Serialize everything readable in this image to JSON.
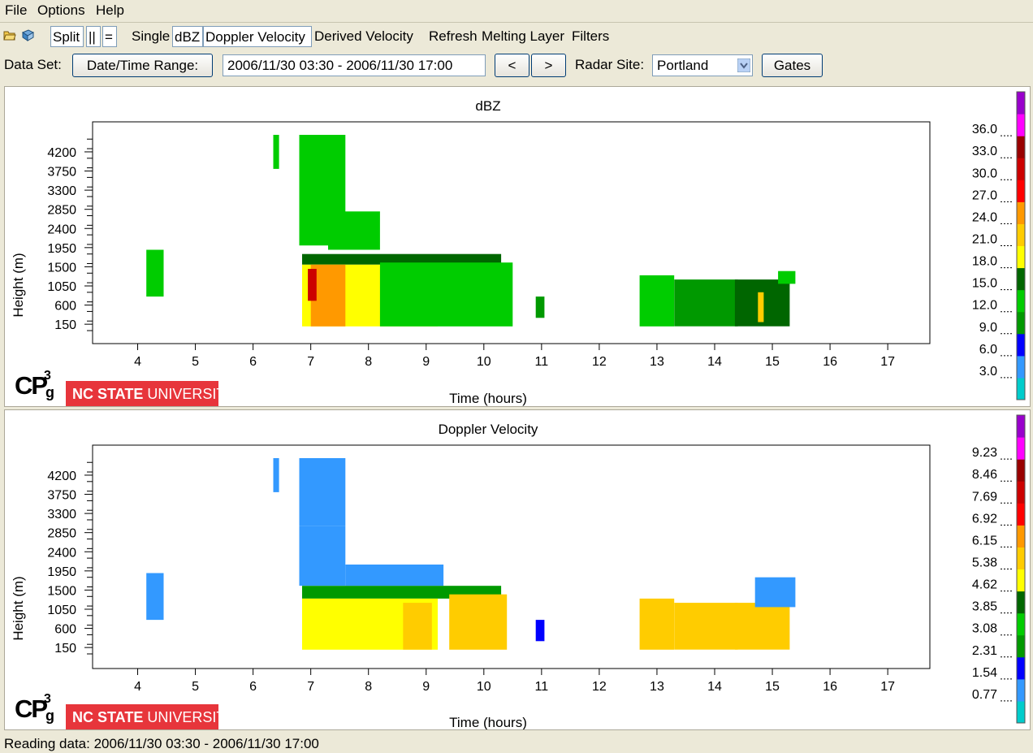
{
  "menu": {
    "items": [
      "File",
      "Options",
      "Help"
    ]
  },
  "toolbar": {
    "open_icon": "open-file-icon",
    "save_icon": "save-icon",
    "split_label": "Split",
    "side_label": "||",
    "stack_label": "=",
    "single_label": "Single",
    "dbz_label": "dBZ",
    "doppler_label": "Doppler Velocity",
    "derived_label": "Derived Velocity",
    "refresh_label": "Refresh",
    "melting_label": "Melting Layer",
    "filters_label": "Filters"
  },
  "dataset": {
    "label": "Data Set:",
    "range_button": "Date/Time Range:",
    "range_value": "2006/11/30 03:30 - 2006/11/30 17:00",
    "prev_label": "<",
    "next_label": ">",
    "site_label": "Radar Site:",
    "site_value": "Portland",
    "gates_label": "Gates"
  },
  "logo": {
    "cp": "CP",
    "g": "g",
    "three": "3",
    "banner_bold": "NC STATE",
    "banner_light": " UNIVERSITY"
  },
  "colors": {
    "dbz_scale": [
      "#00cccc",
      "#3399ff",
      "#0000ff",
      "#009900",
      "#00cc00",
      "#006600",
      "#ffff00",
      "#ffcc00",
      "#ff9900",
      "#ff0000",
      "#cc0000",
      "#990000",
      "#ff00ff",
      "#9900cc"
    ],
    "vel_scale": [
      "#00cccc",
      "#3399ff",
      "#0000ff",
      "#009900",
      "#00cc00",
      "#006600",
      "#ffff00",
      "#ffcc00",
      "#ff9900",
      "#ff0000",
      "#cc0000",
      "#990000",
      "#ff00ff",
      "#9900cc"
    ]
  },
  "chart_data": [
    {
      "type": "heatmap",
      "title": "dBZ",
      "xlabel": "Time (hours)",
      "ylabel": "Height (m)",
      "xlim": [
        3.5,
        17.35
      ],
      "ylim": [
        0,
        4600
      ],
      "x_ticks": [
        "4",
        "5",
        "6",
        "7",
        "8",
        "9",
        "10",
        "11",
        "12",
        "13",
        "14",
        "15",
        "16",
        "17"
      ],
      "y_ticks": [
        "150",
        "600",
        "1050",
        "1500",
        "1950",
        "2400",
        "2850",
        "3300",
        "3750",
        "4200"
      ],
      "colorbar_ticks": [
        "3.0",
        "6.0",
        "9.0",
        "12.0",
        "15.0",
        "18.0",
        "21.0",
        "24.0",
        "27.0",
        "30.0",
        "33.0",
        "36.0"
      ],
      "colorbar_range": [
        0,
        39
      ],
      "regions": [
        {
          "x": [
            4.15,
            4.45
          ],
          "y": [
            800,
            1900
          ],
          "value": 12
        },
        {
          "x": [
            6.35,
            6.45
          ],
          "y": [
            3800,
            4600
          ],
          "value": 12
        },
        {
          "x": [
            6.8,
            7.6
          ],
          "y": [
            2000,
            4600
          ],
          "value": 13
        },
        {
          "x": [
            7.3,
            8.2
          ],
          "y": [
            1900,
            2800
          ],
          "value": 13
        },
        {
          "x": [
            6.85,
            10.3
          ],
          "y": [
            1550,
            1800
          ],
          "value": 16
        },
        {
          "x": [
            6.85,
            9.2
          ],
          "y": [
            100,
            1550
          ],
          "value": 19
        },
        {
          "x": [
            7.0,
            7.6
          ],
          "y": [
            100,
            1550
          ],
          "value": 25
        },
        {
          "x": [
            6.95,
            7.1
          ],
          "y": [
            700,
            1450
          ],
          "value": 29
        },
        {
          "x": [
            8.2,
            10.5
          ],
          "y": [
            100,
            1600
          ],
          "value": 12
        },
        {
          "x": [
            10.9,
            11.05
          ],
          "y": [
            300,
            800
          ],
          "value": 11
        },
        {
          "x": [
            12.7,
            13.3
          ],
          "y": [
            100,
            1300
          ],
          "value": 12
        },
        {
          "x": [
            13.3,
            14.4
          ],
          "y": [
            100,
            1200
          ],
          "value": 11
        },
        {
          "x": [
            14.35,
            15.3
          ],
          "y": [
            100,
            1200
          ],
          "value": 15
        },
        {
          "x": [
            14.75,
            14.85
          ],
          "y": [
            200,
            900
          ],
          "value": 20
        },
        {
          "x": [
            15.1,
            15.4
          ],
          "y": [
            1100,
            1400
          ],
          "value": 12
        }
      ]
    },
    {
      "type": "heatmap",
      "title": "Doppler Velocity",
      "xlabel": "Time (hours)",
      "ylabel": "Height (m)",
      "xlim": [
        3.5,
        17.35
      ],
      "ylim": [
        0,
        4600
      ],
      "x_ticks": [
        "4",
        "5",
        "6",
        "7",
        "8",
        "9",
        "10",
        "11",
        "12",
        "13",
        "14",
        "15",
        "16",
        "17"
      ],
      "y_ticks": [
        "150",
        "600",
        "1050",
        "1500",
        "1950",
        "2400",
        "2850",
        "3300",
        "3750",
        "4200"
      ],
      "colorbar_ticks": [
        "0.77",
        "1.54",
        "2.31",
        "3.08",
        "3.85",
        "4.62",
        "5.38",
        "6.15",
        "6.92",
        "7.69",
        "8.46",
        "9.23"
      ],
      "colorbar_range": [
        0,
        10
      ],
      "regions": [
        {
          "x": [
            4.15,
            4.45
          ],
          "y": [
            800,
            1900
          ],
          "value": 1.3
        },
        {
          "x": [
            6.35,
            6.45
          ],
          "y": [
            3800,
            4600
          ],
          "value": 1.3
        },
        {
          "x": [
            6.8,
            7.6
          ],
          "y": [
            3000,
            4600
          ],
          "value": 0.9
        },
        {
          "x": [
            6.8,
            7.6
          ],
          "y": [
            1600,
            3000
          ],
          "value": 1.3
        },
        {
          "x": [
            7.6,
            9.3
          ],
          "y": [
            1600,
            2100
          ],
          "value": 1.3
        },
        {
          "x": [
            6.85,
            10.3
          ],
          "y": [
            1300,
            1600
          ],
          "value": 2.6
        },
        {
          "x": [
            6.85,
            9.2
          ],
          "y": [
            100,
            1300
          ],
          "value": 4.8
        },
        {
          "x": [
            8.6,
            9.1
          ],
          "y": [
            100,
            1200
          ],
          "value": 5.6
        },
        {
          "x": [
            9.4,
            10.4
          ],
          "y": [
            100,
            1400
          ],
          "value": 5.0
        },
        {
          "x": [
            10.9,
            11.05
          ],
          "y": [
            300,
            800
          ],
          "value": 1.5
        },
        {
          "x": [
            12.7,
            13.3
          ],
          "y": [
            100,
            1300
          ],
          "value": 5.5
        },
        {
          "x": [
            13.3,
            14.4
          ],
          "y": [
            100,
            1200
          ],
          "value": 5.2
        },
        {
          "x": [
            14.35,
            15.3
          ],
          "y": [
            100,
            1200
          ],
          "value": 5.0
        },
        {
          "x": [
            14.7,
            15.4
          ],
          "y": [
            1100,
            1800
          ],
          "value": 1.4
        }
      ]
    }
  ],
  "status": {
    "text": "Reading data: 2006/11/30 03:30 - 2006/11/30 17:00"
  }
}
